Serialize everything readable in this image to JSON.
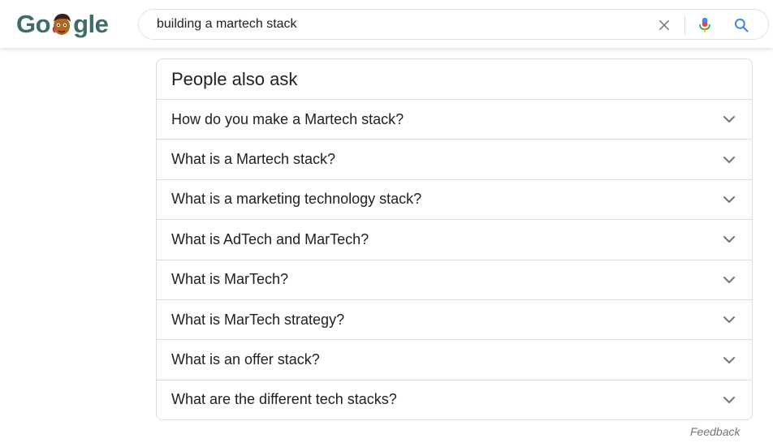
{
  "logo": {
    "letters": [
      "G",
      "o",
      "",
      "g",
      "l",
      "e"
    ],
    "colors": {
      "g1": "#3f6e6b",
      "o1": "#3f6e6b",
      "g2": "#3f6e6b",
      "l": "#3f6e6b",
      "e": "#3f6e6b"
    }
  },
  "search": {
    "value": "building a martech stack",
    "clear_icon": "close-icon",
    "mic_icon": "microphone-icon",
    "search_icon": "search-icon"
  },
  "paa": {
    "title": "People also ask",
    "questions": [
      "How do you make a Martech stack?",
      "What is a Martech stack?",
      "What is a marketing technology stack?",
      "What is AdTech and MarTech?",
      "What is MarTech?",
      "What is MarTech strategy?",
      "What is an offer stack?",
      "What are the different tech stacks?"
    ]
  },
  "footer": {
    "feedback": "Feedback"
  },
  "colors": {
    "accent_blue": "#4285f4",
    "mic_red": "#ea4335",
    "text": "#202124",
    "muted": "#70757a",
    "border": "#dadce0"
  }
}
